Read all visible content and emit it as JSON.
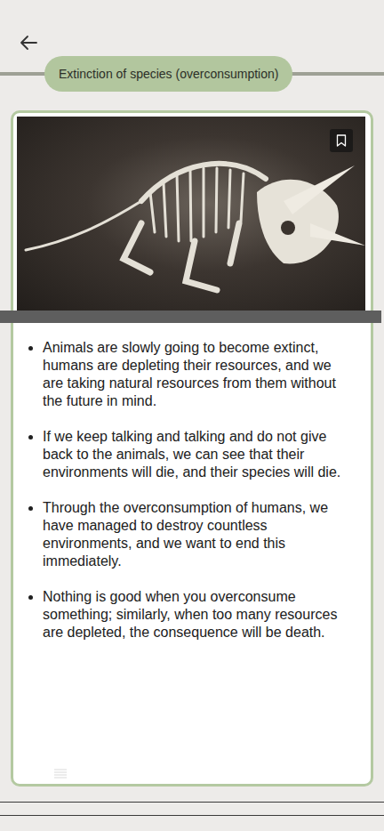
{
  "header": {
    "title": "Extinction of species (overconsumption)"
  },
  "article": {
    "bookmarked": false,
    "bullets": [
      "Animals are slowly going to become extinct, humans are depleting their resources, and we are taking natural resources from them without the future in mind.",
      "If we keep talking and talking and do not give back to the animals, we can see that their environments will die, and their species will die.",
      "Through the overconsumption of humans, we have managed to destroy countless environments, and we want to end this immediately.",
      "Nothing is good when you overconsume something; similarly, when too many resources are depleted, the consequence will be death."
    ]
  }
}
